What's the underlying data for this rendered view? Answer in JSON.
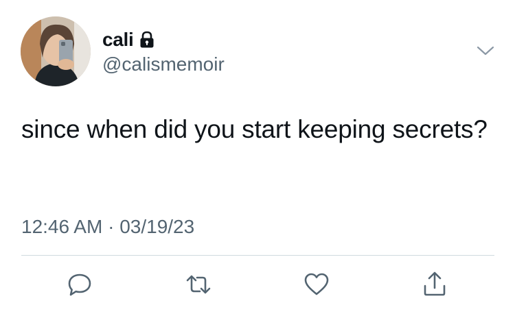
{
  "tweet": {
    "author": {
      "display_name": "cali",
      "handle": "@calismemoir",
      "protected_icon": "lock-icon"
    },
    "menu_icon": "chevron-down-icon",
    "text": "since when did you start keeping secrets?",
    "time": "12:46 AM",
    "separator": "·",
    "date": "03/19/23"
  },
  "actions": [
    {
      "name": "reply",
      "icon": "reply-icon"
    },
    {
      "name": "retweet",
      "icon": "retweet-icon"
    },
    {
      "name": "like",
      "icon": "heart-icon"
    },
    {
      "name": "share",
      "icon": "share-icon"
    }
  ],
  "colors": {
    "text_primary": "#0f1419",
    "text_secondary": "#536471",
    "divider": "#cfd9de",
    "icon": "#536471"
  }
}
